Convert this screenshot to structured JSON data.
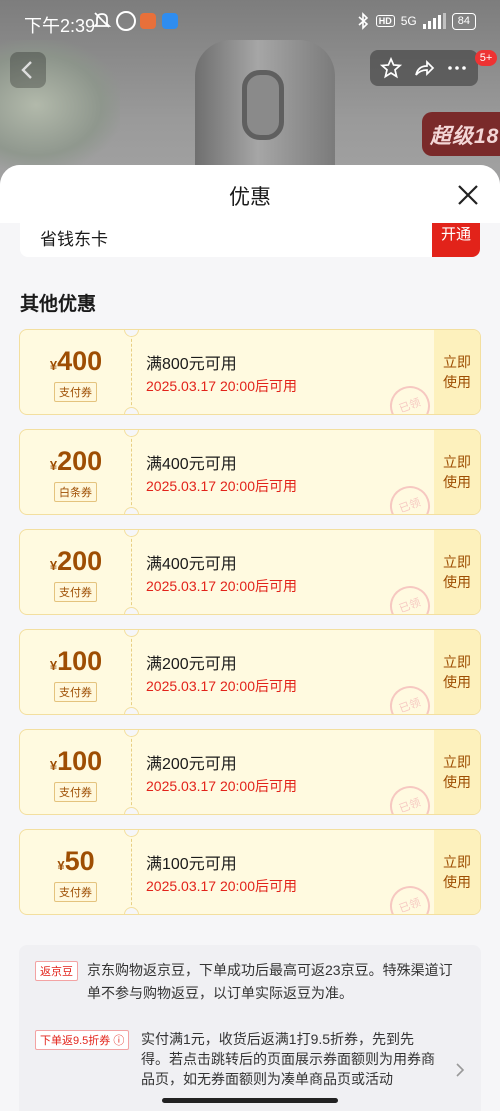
{
  "status_bar": {
    "time": "下午2:39",
    "network": "5G",
    "hd": "HD",
    "battery": "84",
    "icons": [
      "mute-icon",
      "alarm-icon",
      "app-notification-icon",
      "app-notification-icon",
      "bluetooth-icon",
      "signal-icon",
      "battery-icon"
    ]
  },
  "background": {
    "badge_text": "超级18",
    "notification_count": "5+"
  },
  "sheet": {
    "title": "优惠",
    "close_icon": "close-icon"
  },
  "top_card": {
    "label": "省钱东卡",
    "button_label": "开通"
  },
  "other_section": {
    "title": "其他优惠"
  },
  "coupons": [
    {
      "currency": "¥",
      "amount": "400",
      "type": "支付券",
      "condition": "满800元可用",
      "date": "2025.03.17 20:00后可用",
      "action": "立即\n使用",
      "stamp": "已领"
    },
    {
      "currency": "¥",
      "amount": "200",
      "type": "白条券",
      "condition": "满400元可用",
      "date": "2025.03.17 20:00后可用",
      "action": "立即\n使用",
      "stamp": "已领"
    },
    {
      "currency": "¥",
      "amount": "200",
      "type": "支付券",
      "condition": "满400元可用",
      "date": "2025.03.17 20:00后可用",
      "action": "立即\n使用",
      "stamp": "已领"
    },
    {
      "currency": "¥",
      "amount": "100",
      "type": "支付券",
      "condition": "满200元可用",
      "date": "2025.03.17 20:00后可用",
      "action": "立即\n使用",
      "stamp": "已领"
    },
    {
      "currency": "¥",
      "amount": "100",
      "type": "支付券",
      "condition": "满200元可用",
      "date": "2025.03.17 20:00后可用",
      "action": "立即\n使用",
      "stamp": "已领"
    },
    {
      "currency": "¥",
      "amount": "50",
      "type": "支付券",
      "condition": "满100元可用",
      "date": "2025.03.17 20:00后可用",
      "action": "立即\n使用",
      "stamp": "已领"
    }
  ],
  "info": {
    "rebate_tag": "返京豆",
    "rebate_text": "京东购物返京豆，下单成功后最高可返23京豆。特殊渠道订单不参与购物返豆，以订单实际返豆为准。",
    "discount_tag": "下单返9.5折券 ⓘ",
    "discount_text": "实付满1元，收货后返满1打9.5折券，先到先得。若点击跳转后的页面展示券面额则为用券商品页，如无券面额则为凑单商品页或活动"
  },
  "colors": {
    "accent_red": "#e2231a",
    "coupon_brown": "#9e4e03",
    "coupon_bg": "#fffae0"
  }
}
